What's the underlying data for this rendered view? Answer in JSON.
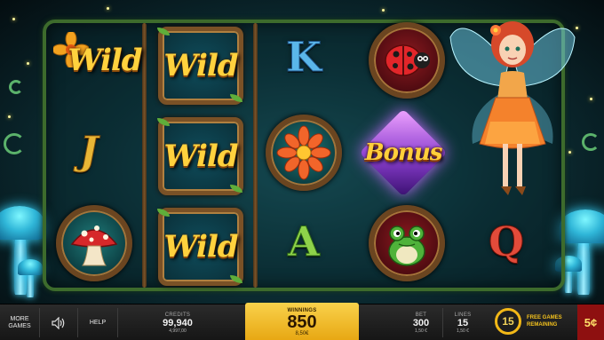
{
  "reels": {
    "wild_label": "Wild",
    "bonus_label": "Bonus",
    "letters": {
      "k": "K",
      "j": "J",
      "a": "A",
      "q": "Q"
    }
  },
  "bottom_bar": {
    "more_games_label": "MORE GAMES",
    "help_label": "HELP",
    "credits_label": "CREDITS",
    "credits_value": "99,940",
    "credits_sub": "4,997,00",
    "winnings_label": "WINNINGS",
    "winnings_value": "850",
    "winnings_sub": "8,50€",
    "bet_label": "BET",
    "bet_value": "300",
    "bet_sub": "1,50 €",
    "lines_label": "LINES",
    "lines_value": "15",
    "lines_sub": "1,50 €",
    "free_games_count": "15",
    "free_games_label": "FREE GAMES REMAINING",
    "denomination": "5¢"
  },
  "colors": {
    "win_panel": "#f2bf2a",
    "denomination_bg": "#8e1010",
    "wild_text": "#ffd23e"
  }
}
